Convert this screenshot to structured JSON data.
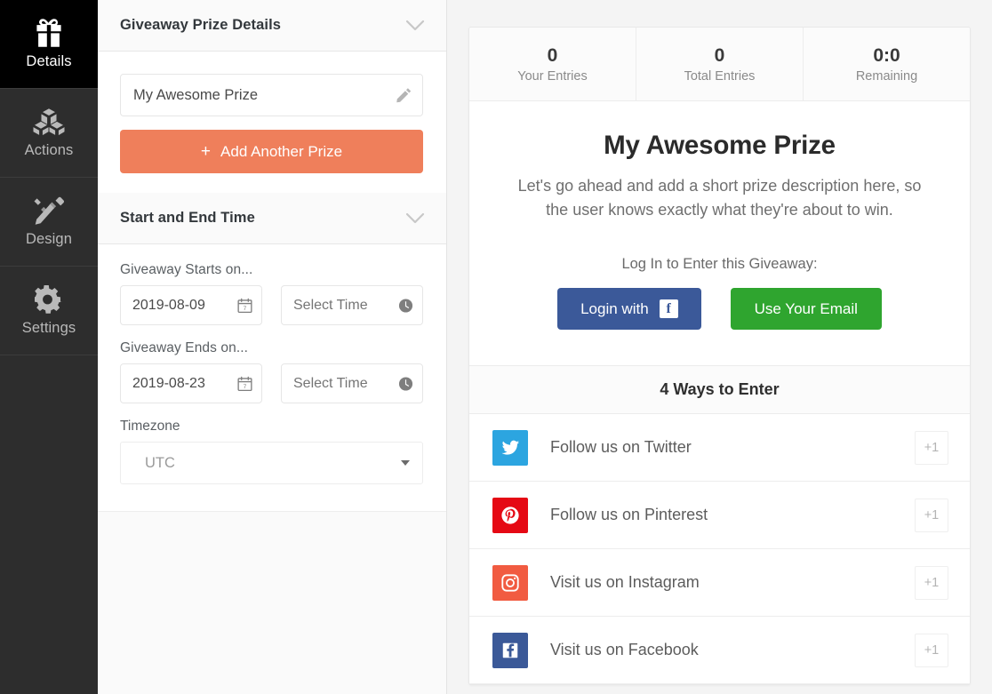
{
  "sidebar": {
    "items": [
      {
        "label": "Details",
        "icon": "gift-icon",
        "active": true
      },
      {
        "label": "Actions",
        "icon": "blocks-icon",
        "active": false
      },
      {
        "label": "Design",
        "icon": "brush-icon",
        "active": false
      },
      {
        "label": "Settings",
        "icon": "gear-icon",
        "active": false
      }
    ]
  },
  "panel": {
    "prize_section": {
      "title": "Giveaway Prize Details",
      "prize_name_value": "My Awesome Prize",
      "edit_icon": "pencil-icon",
      "add_prize_label": "Add Another Prize",
      "add_prize_plus": "+",
      "add_prize_color": "#ef7f5b"
    },
    "time_section": {
      "title": "Start and End Time",
      "starts_label": "Giveaway Starts on...",
      "start_date_value": "2019-08-09",
      "start_time_placeholder": "Select Time",
      "ends_label": "Giveaway Ends on...",
      "end_date_value": "2019-08-23",
      "end_time_placeholder": "Select Time",
      "timezone_label": "Timezone",
      "timezone_value": "UTC",
      "date_icon": "calendar-icon",
      "time_icon": "clock-icon",
      "caret_icon": "caret-down-icon"
    }
  },
  "preview": {
    "stats": [
      {
        "value": "0",
        "label": "Your Entries"
      },
      {
        "value": "0",
        "label": "Total Entries"
      },
      {
        "value": "0:0",
        "label": "Remaining"
      }
    ],
    "prize_title": "My Awesome Prize",
    "prize_description": "Let's go ahead and add a short prize description here, so the user knows exactly what they're about to win.",
    "login_prompt": "Log In to Enter this Giveaway:",
    "facebook_button_label": "Login with",
    "facebook_button_color": "#3b5999",
    "email_button_label": "Use Your Email",
    "email_button_color": "#2fa52f",
    "ways_title": "4 Ways to Enter",
    "entries": [
      {
        "label": "Follow us on Twitter",
        "points": "+1",
        "icon": "twitter-icon",
        "color": "#2ca5e0"
      },
      {
        "label": "Follow us on Pinterest",
        "points": "+1",
        "icon": "pinterest-icon",
        "color": "#e50914"
      },
      {
        "label": "Visit us on Instagram",
        "points": "+1",
        "icon": "instagram-icon",
        "color": "#f15b41"
      },
      {
        "label": "Visit us on Facebook",
        "points": "+1",
        "icon": "facebook-icon",
        "color": "#3b5998"
      }
    ]
  }
}
